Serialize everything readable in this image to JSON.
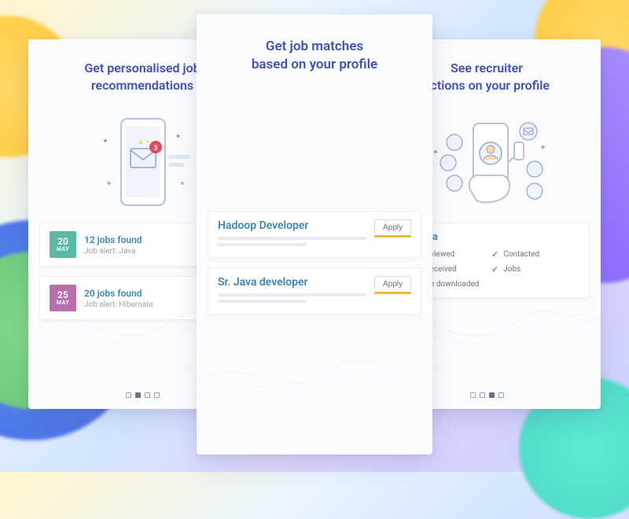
{
  "left": {
    "title_line1": "Get personalised job",
    "title_line2": "recommendations",
    "alerts": [
      {
        "day": "20",
        "month": "MAY",
        "chip_color": "#5cb8a6",
        "title": "12 jobs found",
        "sub": "Job alert: Java"
      },
      {
        "day": "25",
        "month": "MAY",
        "chip_color": "#b86fae",
        "title": "20 jobs found",
        "sub": "Job alert: Hibernate"
      }
    ],
    "dots": {
      "count": 4,
      "active": 1
    }
  },
  "center": {
    "title_line1": "Get job matches",
    "title_line2": "based on your profile",
    "jobs": [
      {
        "title": "Hadoop Developer",
        "apply_label": "Apply"
      },
      {
        "title": "Sr. Java developer",
        "apply_label": "Apply"
      }
    ]
  },
  "right": {
    "title_line1": "See recruiter",
    "title_line2": "actions on your profile",
    "recruiter_name": "HT Media",
    "actions": [
      {
        "label": "Profile viewed",
        "check": true
      },
      {
        "label": "Contacted",
        "check": true
      },
      {
        "label": "Email received",
        "check": true
      },
      {
        "label": "Jobs",
        "check": true
      },
      {
        "label": "Resume downloaded",
        "check": true
      }
    ],
    "dots": {
      "count": 4,
      "active": 2
    }
  }
}
